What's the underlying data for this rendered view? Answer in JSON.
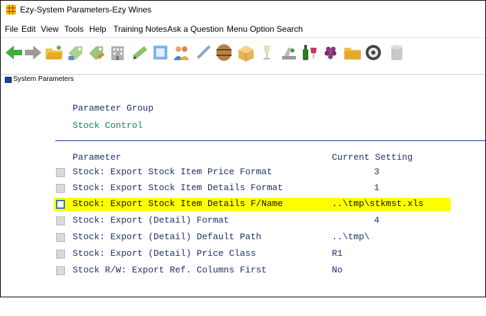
{
  "window": {
    "title": "Ezy-System Parameters-Ezy Wines"
  },
  "menu": [
    "File",
    "Edit",
    "View",
    "Tools",
    "Help",
    "Training Notes",
    "Ask a Question",
    "Menu Option Search"
  ],
  "toolbar": {
    "icons": [
      "back-arrow-icon",
      "forward-arrow-icon",
      "folder-open-icon",
      "tag-add-icon",
      "tag-edit-icon",
      "building-icon",
      "pencil-icon",
      "document-icon",
      "people-icon",
      "pen-icon",
      "barrel-icon",
      "box-icon",
      "glass-icon",
      "scales-icon",
      "wine-icon",
      "grapes-icon",
      "folder-icon",
      "gear-icon",
      "database-icon"
    ]
  },
  "panel": {
    "title": "System Parameters"
  },
  "group": {
    "label": "Parameter Group",
    "value": "Stock Control"
  },
  "table": {
    "header_param": "Parameter",
    "header_setting": "Current Setting",
    "rows": [
      {
        "name": "Stock: Export Stock Item Price Format",
        "value": "3"
      },
      {
        "name": "Stock: Export Stock Item Details Format",
        "value": "1"
      },
      {
        "name": "Stock: Export Stock Item Details F/Name",
        "value": "..\\tmp\\stkmst.xls"
      },
      {
        "name": "Stock: Export (Detail) Format",
        "value": "4"
      },
      {
        "name": "Stock: Export (Detail) Default Path",
        "value": "..\\tmp\\"
      },
      {
        "name": "Stock: Export (Detail) Price Class",
        "value": "R1"
      },
      {
        "name": "Stock R/W: Export Ref. Columns First",
        "value": "No"
      }
    ],
    "selected_index": 2
  },
  "colors": {
    "highlight": "#ffff00",
    "label": "#1f2f6b",
    "group_value": "#0a8c5a",
    "divider": "#1f2f9c",
    "panel_icon": "#1f3d99"
  }
}
